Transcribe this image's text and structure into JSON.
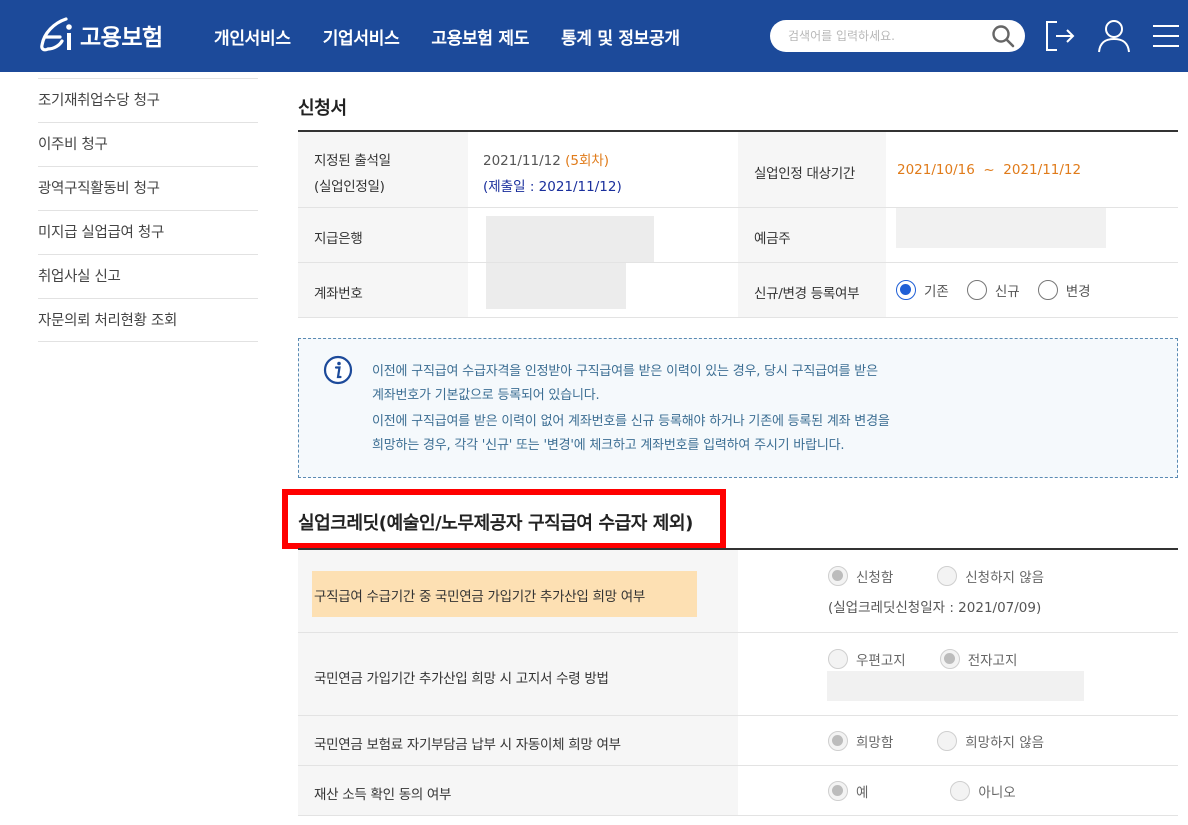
{
  "header": {
    "logo_text": "고용보험",
    "nav": [
      "개인서비스",
      "기업서비스",
      "고용보험 제도",
      "통계 및 정보공개"
    ],
    "search_placeholder": "검색어를 입력하세요."
  },
  "sidebar": {
    "items": [
      {
        "label": "조기재취업수당 청구"
      },
      {
        "label": "이주비 청구"
      },
      {
        "label": "광역구직활동비 청구"
      },
      {
        "label": "미지급 실업급여 청구"
      },
      {
        "label": "취업사실 신고"
      },
      {
        "label": "자문의뢰 처리현황 조회"
      }
    ]
  },
  "application": {
    "title": "신청서",
    "attendance_label_1": "지정된 출석일",
    "attendance_label_2": "(실업인정일)",
    "attendance_date": "2021/11/12",
    "attendance_round": "(5회차)",
    "submission": "(제출일 : 2021/11/12)",
    "period_label": "실업인정 대상기간",
    "period_value": "2021/10/16  ~  2021/11/12",
    "bank_label": "지급은행",
    "holder_label": "예금주",
    "account_label": "계좌번호",
    "register_label": "신규/변경 등록여부",
    "register_options": [
      "기존",
      "신규",
      "변경"
    ]
  },
  "info": {
    "lines": [
      "이전에 구직급여 수급자격을 인정받아 구직급여를 받은 이력이 있는 경우, 당시 구직급여를 받은",
      "계좌번호가 기본값으로 등록되어 있습니다.",
      "이전에 구직급여를 받은 이력이 없어 계좌번호를 신규 등록해야 하거나 기존에 등록된 계좌 변경을",
      "희망하는 경우, 각각 '신규' 또는 '변경'에 체크하고 계좌번호를 입력하여 주시기 바랍니다."
    ]
  },
  "credit": {
    "title": "실업크레딧(예술인/노무제공자 구직급여 수급자 제외)",
    "rows": [
      {
        "label": "구직급여 수급기간 중 국민연금 가입기간 추가산입 희망 여부",
        "options": [
          "신청함",
          "신청하지 않음"
        ],
        "note": "(실업크레딧신청일자 : 2021/07/09)"
      },
      {
        "label": "국민연금 가입기간 추가산입 희망 시 고지서 수령 방법",
        "options": [
          "우편고지",
          "전자고지"
        ]
      },
      {
        "label": "국민연금 보험료 자기부담금 납부 시 자동이체 희망 여부",
        "options": [
          "희망함",
          "희망하지 않음"
        ]
      },
      {
        "label": "재산 소득 확인 동의 여부",
        "options": [
          "예",
          "아니오"
        ]
      }
    ]
  },
  "colors": {
    "header_bg": "#1c4a9a",
    "accent_orange": "#e07b1a",
    "submission_blue": "#1a2f9c",
    "highlight_red": "#ff0000",
    "info_text": "#3c6e93"
  }
}
